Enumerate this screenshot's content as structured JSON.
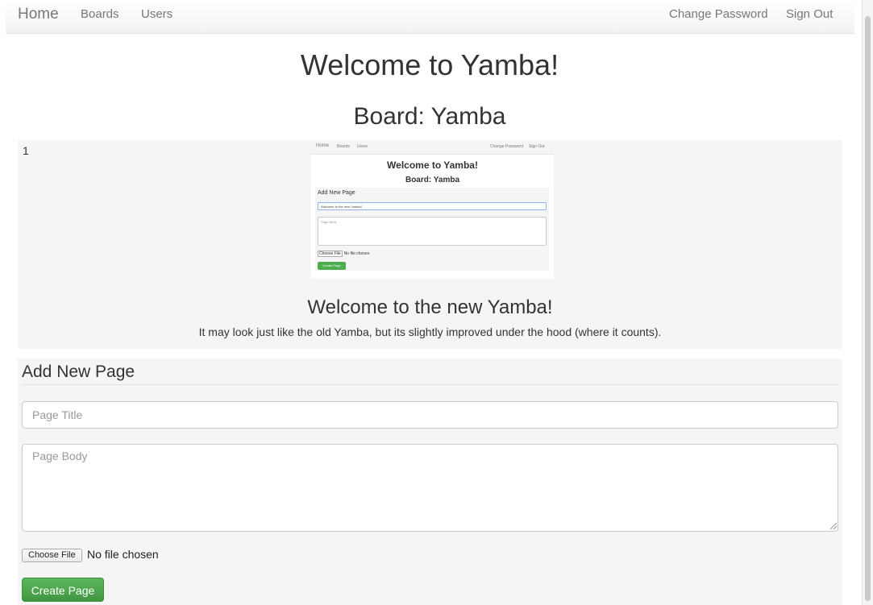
{
  "nav": {
    "brand": "Home",
    "boards": "Boards",
    "users": "Users",
    "change_password": "Change Password",
    "sign_out": "Sign Out"
  },
  "heading": "Welcome to Yamba!",
  "board_title": "Board: Yamba",
  "page": {
    "index": "1",
    "screenshot": {
      "nav_home": "Home",
      "nav_boards": "Boards",
      "nav_users": "Users",
      "nav_change_password": "Change Password",
      "nav_sign_out": "Sign Out",
      "heading": "Welcome to Yamba!",
      "board_title": "Board: Yamba",
      "form_title": "Add New Page",
      "title_value": "Welcome to the new Yamba!",
      "body_placeholder": "Page Body",
      "file_button": "Choose File",
      "file_status": "No file chosen",
      "create_button": "Create Page"
    },
    "title": "Welcome to the new Yamba!",
    "body": "It may look just like the old Yamba, but its slightly improved under the hood (where it counts)."
  },
  "form": {
    "title": "Add New Page",
    "title_placeholder": "Page Title",
    "body_placeholder": "Page Body",
    "file_button": "Choose File",
    "file_status": "No file chosen",
    "submit_label": "Create Page"
  },
  "colors": {
    "accent": "#5cb85c",
    "panel_bg": "#f5f5f5"
  }
}
